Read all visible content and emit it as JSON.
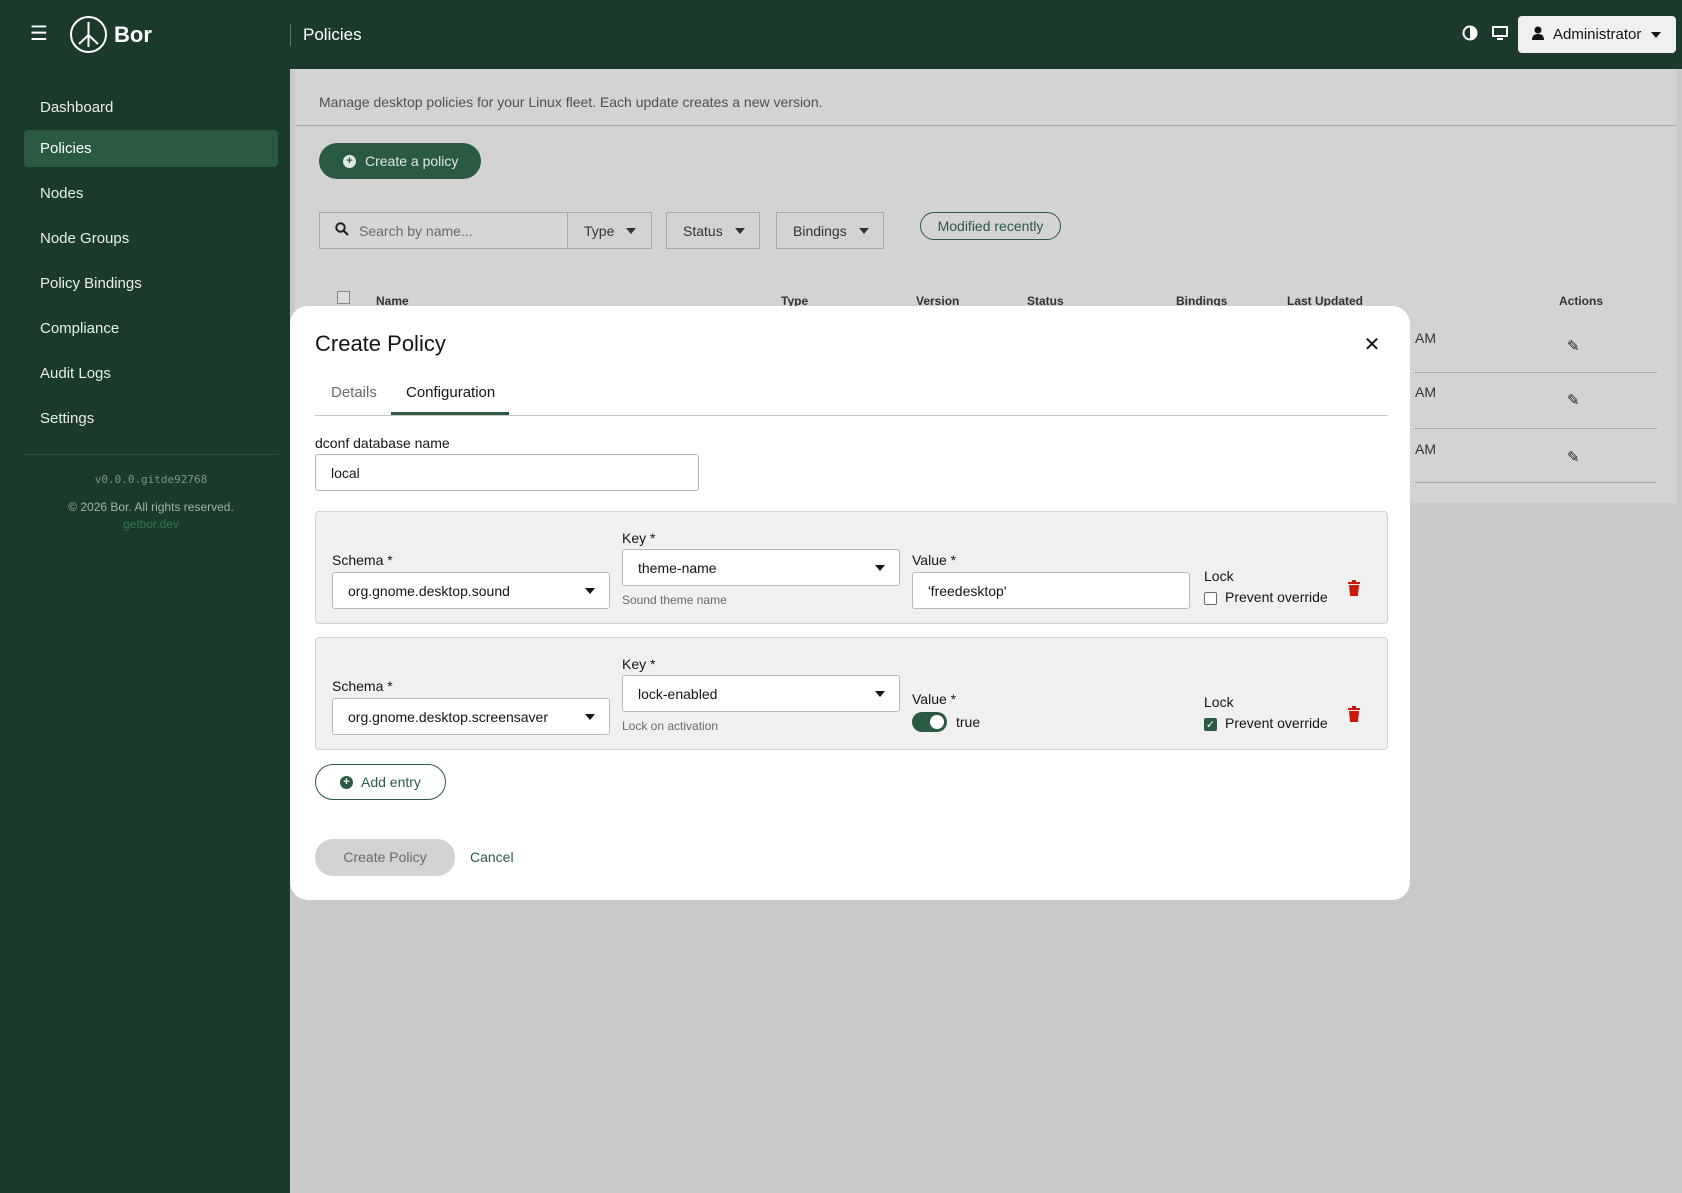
{
  "app": {
    "brand": "Bor",
    "page_title": "Policies"
  },
  "header": {
    "user_label": "Administrator"
  },
  "sidebar": {
    "items": [
      {
        "label": "Dashboard"
      },
      {
        "label": "Policies"
      },
      {
        "label": "Nodes"
      },
      {
        "label": "Node Groups"
      },
      {
        "label": "Policy Bindings"
      },
      {
        "label": "Compliance"
      },
      {
        "label": "Audit Logs"
      },
      {
        "label": "Settings"
      }
    ],
    "version": "v0.0.0.gitde92768",
    "copyright": "© 2026 Bor. All rights reserved.",
    "site": "getbor.dev"
  },
  "page": {
    "description": "Manage desktop policies for your Linux fleet. Each update creates a new version.",
    "create_button": "Create a policy",
    "search_placeholder": "Search by name...",
    "filters": {
      "type": "Type",
      "status": "Status",
      "bindings": "Bindings"
    },
    "chip": "Modified recently",
    "table": {
      "columns": {
        "name": "Name",
        "type": "Type",
        "version": "Version",
        "status": "Status",
        "bindings": "Bindings",
        "last_updated": "Last Updated",
        "actions": "Actions"
      },
      "rows": [
        {
          "last_updated_partial": "AM"
        },
        {
          "last_updated_partial": "AM"
        },
        {
          "last_updated_partial": "AM"
        }
      ]
    }
  },
  "modal": {
    "title": "Create Policy",
    "tabs": {
      "details": "Details",
      "configuration": "Configuration"
    },
    "db_name_label": "dconf database name",
    "db_name_value": "local",
    "labels": {
      "schema": "Schema *",
      "key": "Key *",
      "value": "Value *",
      "lock": "Lock",
      "prevent_override": "Prevent override"
    },
    "entries": [
      {
        "schema": "org.gnome.desktop.sound",
        "key": "theme-name",
        "key_help": "Sound theme name",
        "value": "'freedesktop'",
        "lock": false
      },
      {
        "schema": "org.gnome.desktop.screensaver",
        "key": "lock-enabled",
        "key_help": "Lock on activation",
        "value": "true",
        "lock": true
      }
    ],
    "add_entry": "Add entry",
    "submit": "Create Policy",
    "cancel": "Cancel"
  },
  "colors": {
    "primary": "#2b5a43",
    "topbar": "#1b3a2c",
    "danger": "#c9190b"
  }
}
